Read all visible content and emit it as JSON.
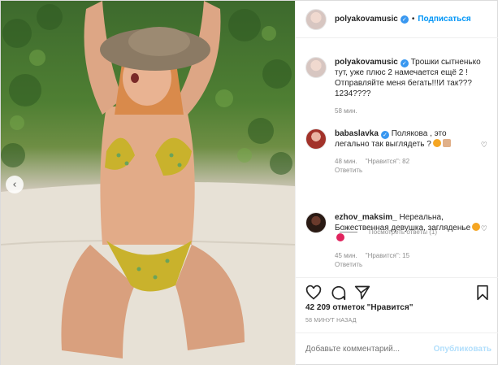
{
  "header": {
    "username": "polyakovamusic",
    "separator": "•",
    "follow_label": "Подписаться"
  },
  "caption": {
    "username": "polyakovamusic",
    "text": "Трошки сытненько тут, уже плюс 2 намечается ещё 2 ! Отправляйте меня бегать!!!И так??? 1234????",
    "time": "58 мин."
  },
  "comments": [
    {
      "username": "babaslavka",
      "text": "Полякова , это легально так выглядеть ?",
      "time": "48 мин.",
      "likes": "\"Нравится\": 82",
      "reply": "Ответить"
    },
    {
      "username": "ezhov_maksim_",
      "text": "Нереальна, Божественная девушка, загляденье",
      "time": "45 мин.",
      "likes": "\"Нравится\": 15",
      "reply": "Ответить"
    }
  ],
  "view_replies": "Посмотреть ответы (1)",
  "likes_text": "42 209 отметок \"Нравится\"",
  "posted_time": "58 МИНУТ НАЗАД",
  "add_comment": {
    "placeholder": "Добавьте комментарий...",
    "publish_label": "Опубликовать"
  },
  "icons": {
    "verified": "verified-badge-icon",
    "like": "heart-icon",
    "comment": "comment-icon",
    "share": "paper-plane-icon",
    "save": "bookmark-icon",
    "prev": "chevron-left-icon"
  },
  "colors": {
    "accent": "#0095f6",
    "verified": "#3897f0",
    "muted": "#8e8e8e"
  }
}
